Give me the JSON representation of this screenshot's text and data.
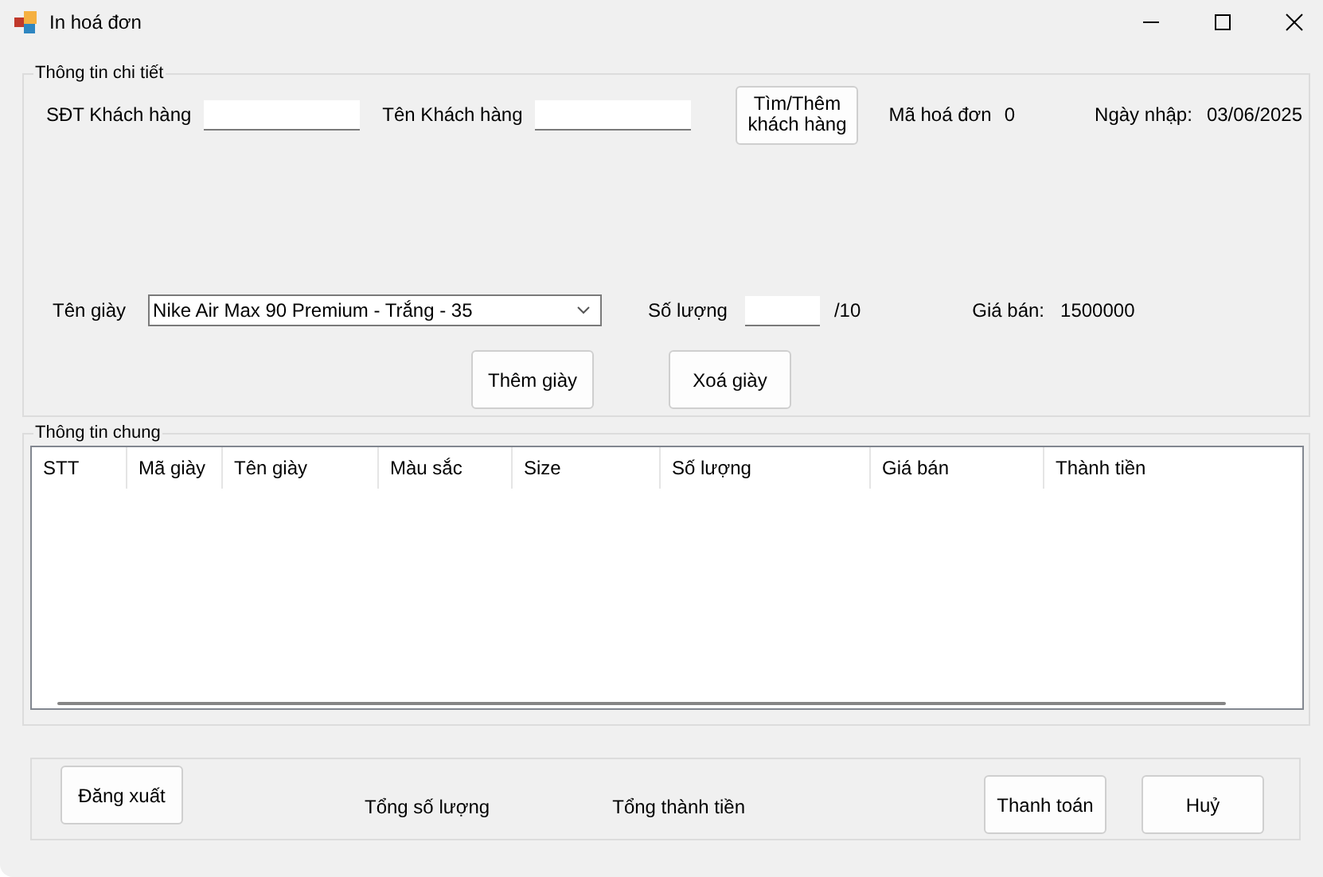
{
  "window": {
    "title": "In hoá đơn"
  },
  "details": {
    "title": "Thông tin chi tiết",
    "phone_label": "SĐT Khách hàng",
    "name_label": "Tên Khách hàng",
    "find_button": "Tìm/Thêm khách hàng",
    "invoice_label": "Mã hoá đơn",
    "invoice_value": "0",
    "date_label": "Ngày nhập:",
    "date_value": "03/06/2025",
    "shoe_label": "Tên giày",
    "shoe_value": "Nike Air Max 90 Premium - Trắng - 35",
    "qty_label": "Số lượng",
    "qty_max": "/10",
    "price_label": "Giá bán:",
    "price_value": "1500000",
    "add_button": "Thêm giày",
    "remove_button": "Xoá giày"
  },
  "general": {
    "title": "Thông tin chung",
    "table": {
      "columns": [
        "STT",
        "Mã giày",
        "Tên giày",
        "Màu sắc",
        "Size",
        "Số lượng",
        "Giá bán",
        "Thành tiền"
      ]
    }
  },
  "footer": {
    "logout_button": "Đăng xuất",
    "total_qty_label": "Tổng số lượng",
    "total_amount_label": "Tổng thành tiền",
    "pay_button": "Thanh toán",
    "cancel_button": "Huỷ"
  }
}
